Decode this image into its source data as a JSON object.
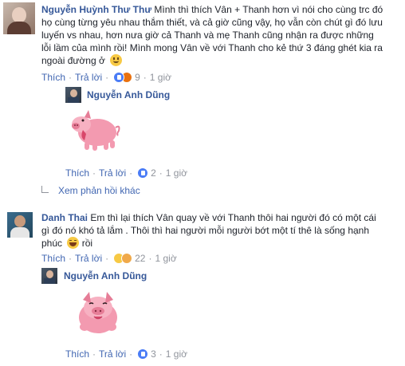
{
  "comments": [
    {
      "author": "Nguyễn Huỳnh Thư Thư",
      "text_lines": [
        "Mình thì thích Vân + Thanh hơn vì nói cho cùng trc đó",
        "họ cùng từng yêu nhau thắm thiết, và cả giờ cũng vậy, họ vẫn còn chút gì đó lưu",
        "luyến vs nhau, hơn nưa giờ cả Thanh và mẹ Thanh cũng nhận ra được những",
        "lỗi lầm của mình rồi! Mình mong Vân về với Thanh cho kẻ thứ 3 đáng ghét kia ra",
        "ngoài đường ở"
      ],
      "like_label": "Thích",
      "reply_label": "Trả lời",
      "reaction_count": "9",
      "time": "1 giờ",
      "reply": {
        "author": "Nguyễn Anh Dũng",
        "like_label": "Thích",
        "reply_label": "Trả lời",
        "reaction_count": "2",
        "time": "1 giờ"
      },
      "more_replies": "Xem phản hồi khác"
    },
    {
      "author": "Danh Thai",
      "text_lines": [
        "Em thì lại thích Vân quay về với Thanh thôi hai người đó có một cái",
        "gì đó nó khó tả lắm . Thôi thì hai người mỗi người bớt một tí thê là sống hạnh",
        "phúc",
        "rồi"
      ],
      "like_label": "Thích",
      "reply_label": "Trả lời",
      "reaction_count": "22",
      "time": "1 giờ",
      "reply": {
        "author": "Nguyễn Anh Dũng",
        "like_label": "Thích",
        "reply_label": "Trả lời",
        "reaction_count": "3",
        "time": "1 giờ"
      }
    }
  ],
  "colors": {
    "link": "#4267b2",
    "name": "#365899",
    "meta": "#90949c",
    "sticker_pink": "#f39ab0"
  }
}
